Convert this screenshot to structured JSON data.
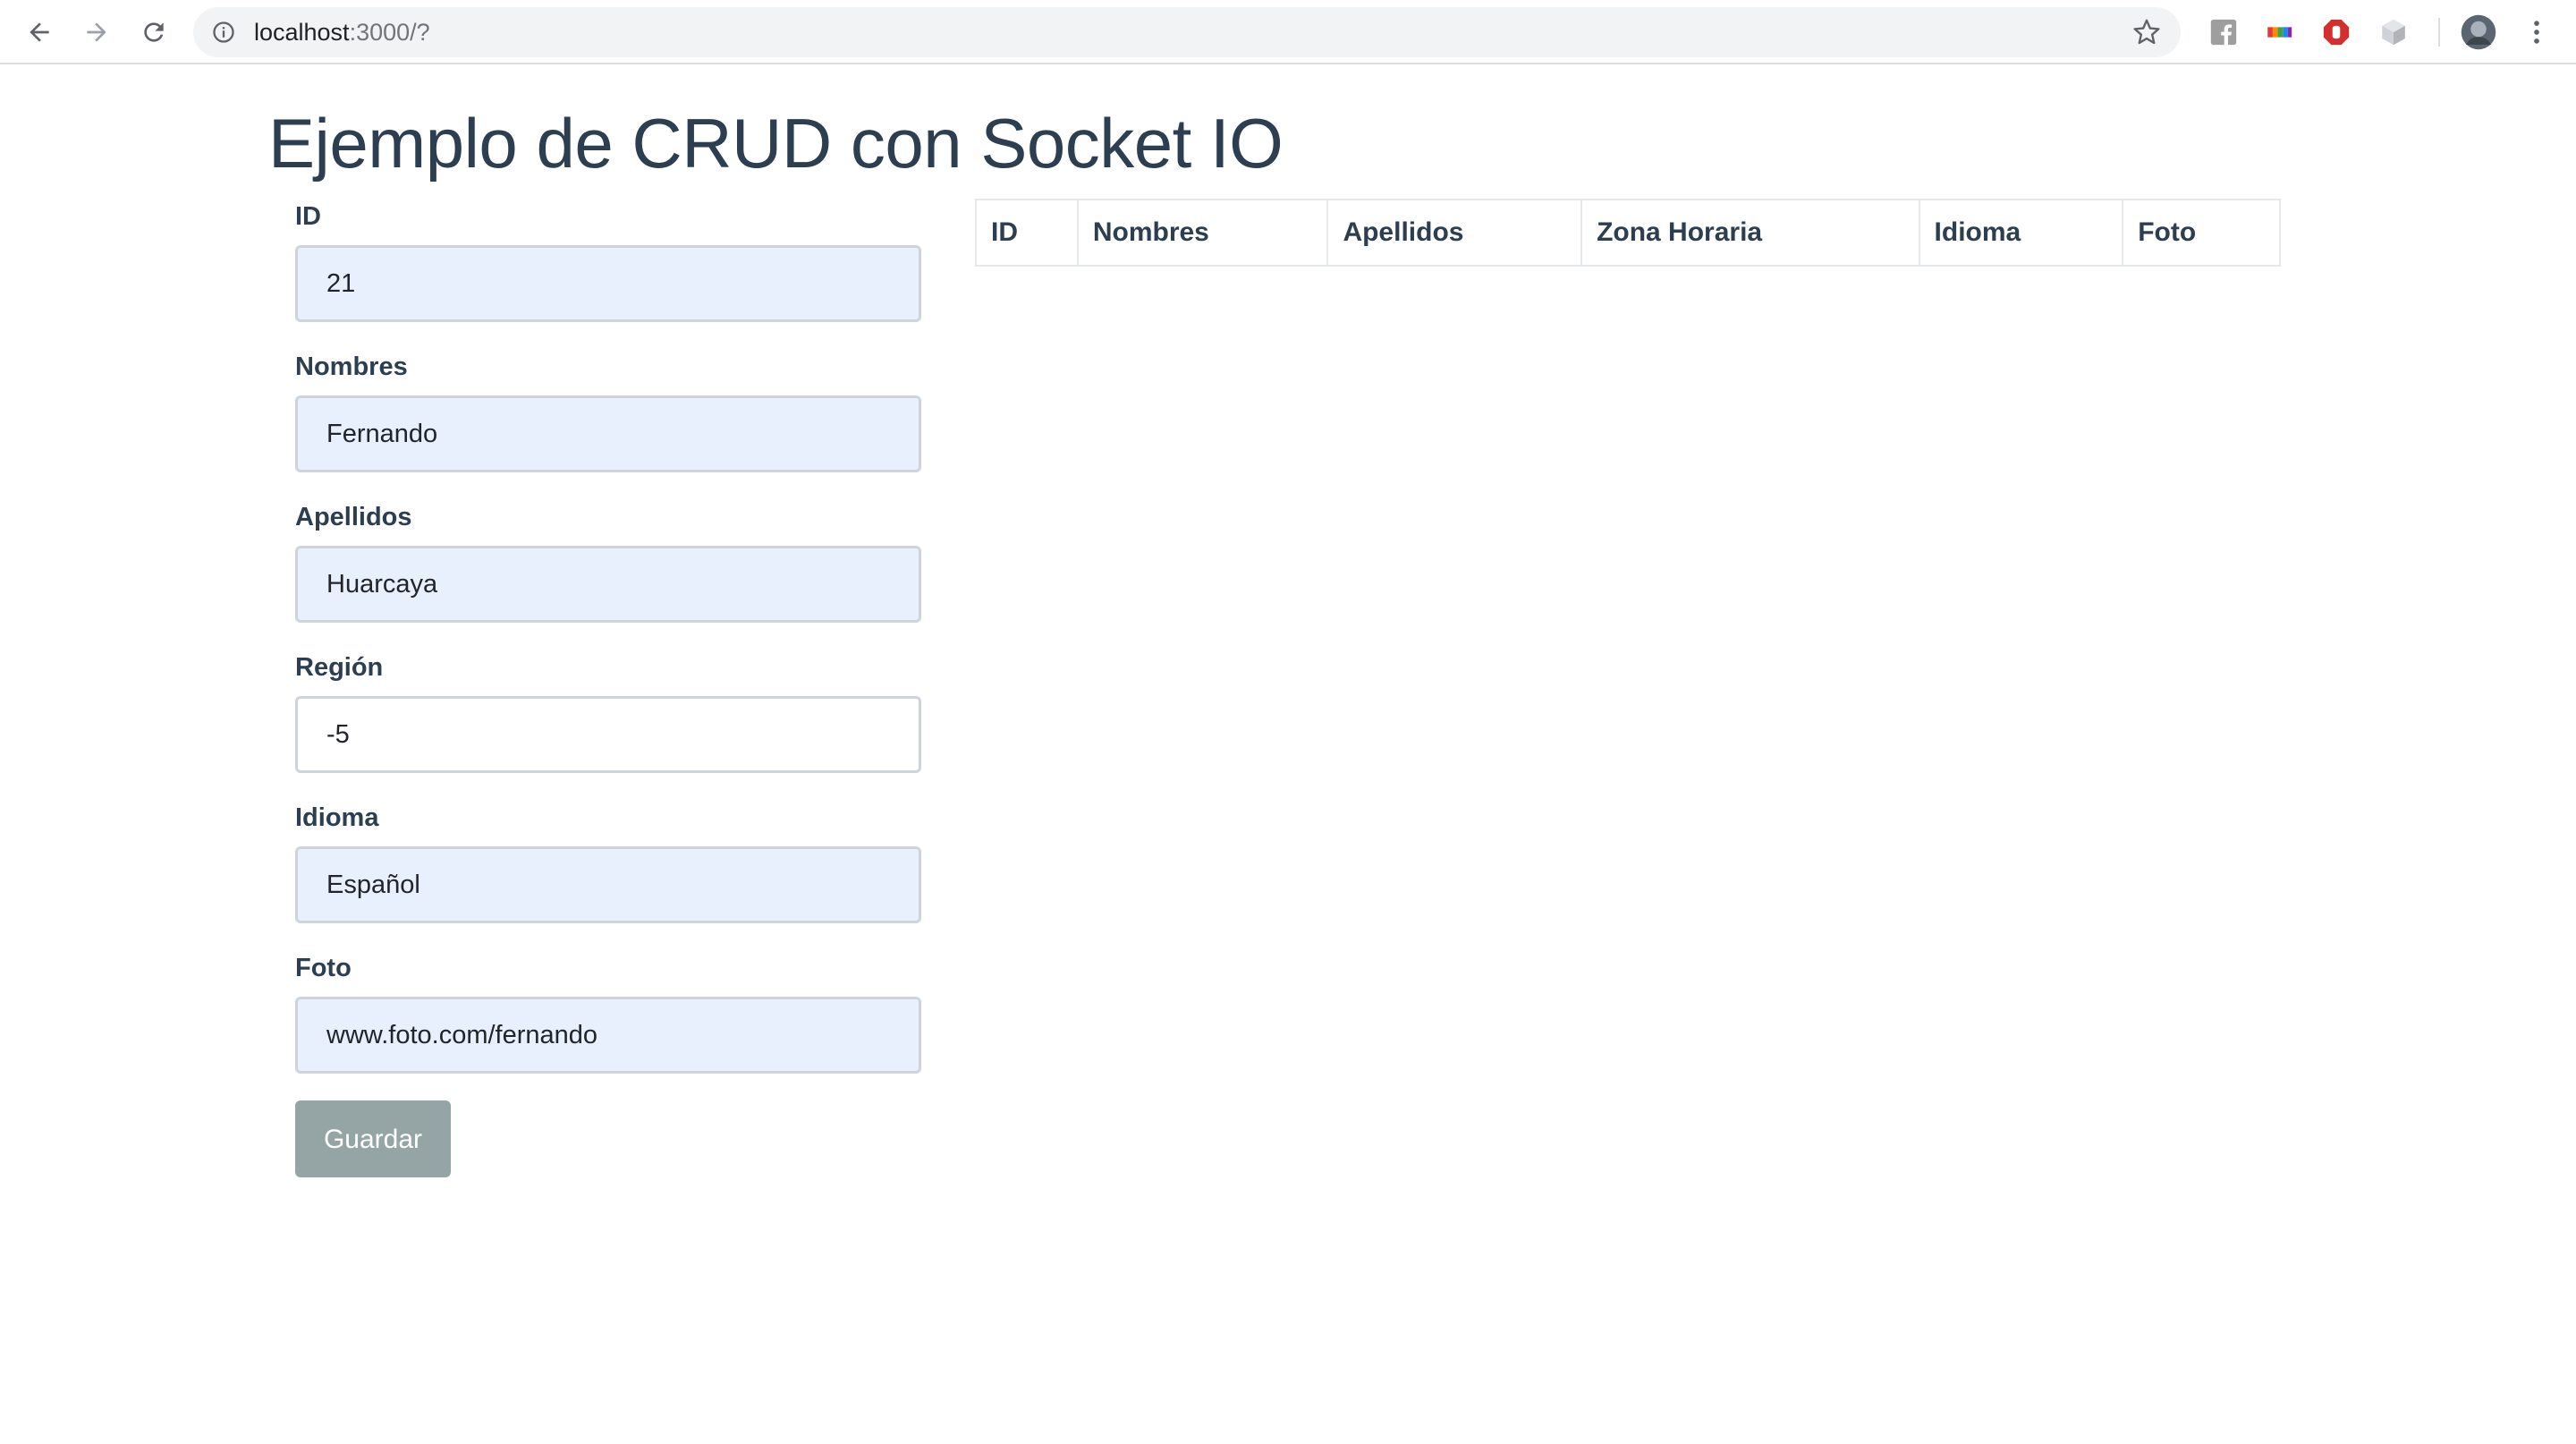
{
  "browser": {
    "url_host": "localhost",
    "url_rest": ":3000/?",
    "nav": {
      "back_icon": "arrow-left-icon",
      "forward_icon": "arrow-right-icon",
      "reload_icon": "reload-icon"
    },
    "extensions": [
      "facebook-icon",
      "rainbow-extension-icon",
      "stop-sign-icon",
      "cube-icon"
    ],
    "profile_icon": "avatar-icon",
    "menu_icon": "kebab-menu-icon"
  },
  "page": {
    "title": "Ejemplo de CRUD con Socket IO"
  },
  "form": {
    "fields": [
      {
        "label": "ID",
        "value": "21"
      },
      {
        "label": "Nombres",
        "value": "Fernando"
      },
      {
        "label": "Apellidos",
        "value": "Huarcaya"
      },
      {
        "label": "Región",
        "value": "-5"
      },
      {
        "label": "Idioma",
        "value": "Español"
      },
      {
        "label": "Foto",
        "value": "www.foto.com/fernando"
      }
    ],
    "save_label": "Guardar"
  },
  "table": {
    "columns": [
      "ID",
      "Nombres",
      "Apellidos",
      "Zona Horaria",
      "Idioma",
      "Foto"
    ],
    "rows": []
  },
  "colors": {
    "heading": "#2c3e50",
    "autofill_bg": "#e8f0fe",
    "button_bg": "#95a5a6"
  }
}
